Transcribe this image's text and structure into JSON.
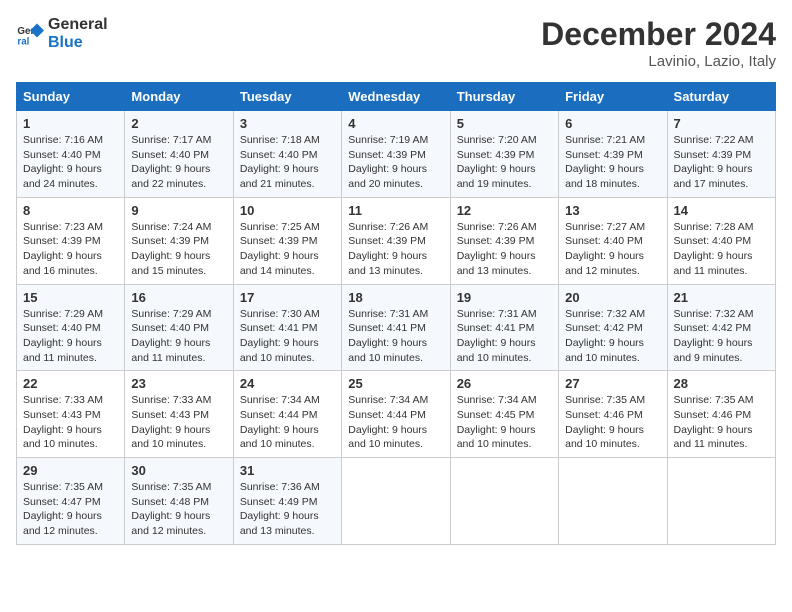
{
  "logo": {
    "line1": "General",
    "line2": "Blue"
  },
  "title": "December 2024",
  "subtitle": "Lavinio, Lazio, Italy",
  "days_of_week": [
    "Sunday",
    "Monday",
    "Tuesday",
    "Wednesday",
    "Thursday",
    "Friday",
    "Saturday"
  ],
  "weeks": [
    [
      {
        "day": "1",
        "sunrise": "7:16 AM",
        "sunset": "4:40 PM",
        "daylight": "9 hours and 24 minutes."
      },
      {
        "day": "2",
        "sunrise": "7:17 AM",
        "sunset": "4:40 PM",
        "daylight": "9 hours and 22 minutes."
      },
      {
        "day": "3",
        "sunrise": "7:18 AM",
        "sunset": "4:40 PM",
        "daylight": "9 hours and 21 minutes."
      },
      {
        "day": "4",
        "sunrise": "7:19 AM",
        "sunset": "4:39 PM",
        "daylight": "9 hours and 20 minutes."
      },
      {
        "day": "5",
        "sunrise": "7:20 AM",
        "sunset": "4:39 PM",
        "daylight": "9 hours and 19 minutes."
      },
      {
        "day": "6",
        "sunrise": "7:21 AM",
        "sunset": "4:39 PM",
        "daylight": "9 hours and 18 minutes."
      },
      {
        "day": "7",
        "sunrise": "7:22 AM",
        "sunset": "4:39 PM",
        "daylight": "9 hours and 17 minutes."
      }
    ],
    [
      {
        "day": "8",
        "sunrise": "7:23 AM",
        "sunset": "4:39 PM",
        "daylight": "9 hours and 16 minutes."
      },
      {
        "day": "9",
        "sunrise": "7:24 AM",
        "sunset": "4:39 PM",
        "daylight": "9 hours and 15 minutes."
      },
      {
        "day": "10",
        "sunrise": "7:25 AM",
        "sunset": "4:39 PM",
        "daylight": "9 hours and 14 minutes."
      },
      {
        "day": "11",
        "sunrise": "7:26 AM",
        "sunset": "4:39 PM",
        "daylight": "9 hours and 13 minutes."
      },
      {
        "day": "12",
        "sunrise": "7:26 AM",
        "sunset": "4:39 PM",
        "daylight": "9 hours and 13 minutes."
      },
      {
        "day": "13",
        "sunrise": "7:27 AM",
        "sunset": "4:40 PM",
        "daylight": "9 hours and 12 minutes."
      },
      {
        "day": "14",
        "sunrise": "7:28 AM",
        "sunset": "4:40 PM",
        "daylight": "9 hours and 11 minutes."
      }
    ],
    [
      {
        "day": "15",
        "sunrise": "7:29 AM",
        "sunset": "4:40 PM",
        "daylight": "9 hours and 11 minutes."
      },
      {
        "day": "16",
        "sunrise": "7:29 AM",
        "sunset": "4:40 PM",
        "daylight": "9 hours and 11 minutes."
      },
      {
        "day": "17",
        "sunrise": "7:30 AM",
        "sunset": "4:41 PM",
        "daylight": "9 hours and 10 minutes."
      },
      {
        "day": "18",
        "sunrise": "7:31 AM",
        "sunset": "4:41 PM",
        "daylight": "9 hours and 10 minutes."
      },
      {
        "day": "19",
        "sunrise": "7:31 AM",
        "sunset": "4:41 PM",
        "daylight": "9 hours and 10 minutes."
      },
      {
        "day": "20",
        "sunrise": "7:32 AM",
        "sunset": "4:42 PM",
        "daylight": "9 hours and 10 minutes."
      },
      {
        "day": "21",
        "sunrise": "7:32 AM",
        "sunset": "4:42 PM",
        "daylight": "9 hours and 9 minutes."
      }
    ],
    [
      {
        "day": "22",
        "sunrise": "7:33 AM",
        "sunset": "4:43 PM",
        "daylight": "9 hours and 10 minutes."
      },
      {
        "day": "23",
        "sunrise": "7:33 AM",
        "sunset": "4:43 PM",
        "daylight": "9 hours and 10 minutes."
      },
      {
        "day": "24",
        "sunrise": "7:34 AM",
        "sunset": "4:44 PM",
        "daylight": "9 hours and 10 minutes."
      },
      {
        "day": "25",
        "sunrise": "7:34 AM",
        "sunset": "4:44 PM",
        "daylight": "9 hours and 10 minutes."
      },
      {
        "day": "26",
        "sunrise": "7:34 AM",
        "sunset": "4:45 PM",
        "daylight": "9 hours and 10 minutes."
      },
      {
        "day": "27",
        "sunrise": "7:35 AM",
        "sunset": "4:46 PM",
        "daylight": "9 hours and 10 minutes."
      },
      {
        "day": "28",
        "sunrise": "7:35 AM",
        "sunset": "4:46 PM",
        "daylight": "9 hours and 11 minutes."
      }
    ],
    [
      {
        "day": "29",
        "sunrise": "7:35 AM",
        "sunset": "4:47 PM",
        "daylight": "9 hours and 12 minutes."
      },
      {
        "day": "30",
        "sunrise": "7:35 AM",
        "sunset": "4:48 PM",
        "daylight": "9 hours and 12 minutes."
      },
      {
        "day": "31",
        "sunrise": "7:36 AM",
        "sunset": "4:49 PM",
        "daylight": "9 hours and 13 minutes."
      },
      null,
      null,
      null,
      null
    ]
  ]
}
